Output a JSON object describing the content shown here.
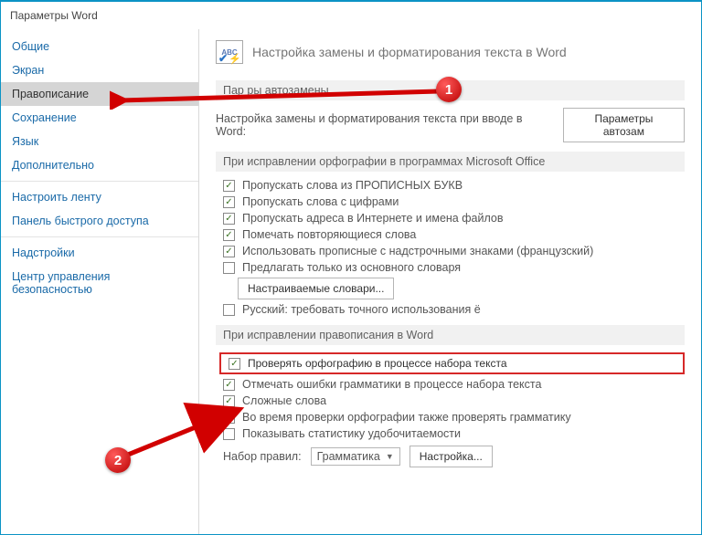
{
  "window": {
    "title": "Параметры Word"
  },
  "sidebar": {
    "items": [
      {
        "label": "Общие"
      },
      {
        "label": "Экран"
      },
      {
        "label": "Правописание"
      },
      {
        "label": "Сохранение"
      },
      {
        "label": "Язык"
      },
      {
        "label": "Дополнительно"
      },
      {
        "label": "Настроить ленту"
      },
      {
        "label": "Панель быстрого доступа"
      },
      {
        "label": "Надстройки"
      },
      {
        "label": "Центр управления безопасностью"
      }
    ]
  },
  "header": {
    "icon_text": "ABC",
    "title": "Настройка замены и форматирования текста в Word"
  },
  "autocorrect": {
    "section": "Пар        ры автозамены",
    "label": "Настройка замены и форматирования текста при вводе в Word:",
    "button": "Параметры автозам"
  },
  "sections": {
    "office": "При исправлении орфографии в программах Microsoft Office",
    "word": "При исправлении правописания в Word"
  },
  "office_checks": {
    "c0": "Пропускать слова из ПРОПИСНЫХ БУКВ",
    "c1": "Пропускать слова с цифрами",
    "c2": "Пропускать адреса в Интернете и имена файлов",
    "c3": "Помечать повторяющиеся слова",
    "c4": "Использовать прописные с надстрочными знаками (французский)",
    "c5": "Предлагать только из основного словаря",
    "dict_btn": "Настраиваемые словари...",
    "c6": "Русский: требовать точного использования ё"
  },
  "word_checks": {
    "c0": "Проверять орфографию в процессе набора текста",
    "c1": "Отмечать ошибки грамматики в процессе набора текста",
    "c2": "Сложные слова",
    "c3": "Во время проверки орфографии также проверять грамматику",
    "c4": "Показывать статистику удобочитаемости"
  },
  "rules": {
    "label": "Набор правил:",
    "value": "Грамматика",
    "settings_btn": "Настройка..."
  },
  "annotations": {
    "n1": "1",
    "n2": "2"
  }
}
